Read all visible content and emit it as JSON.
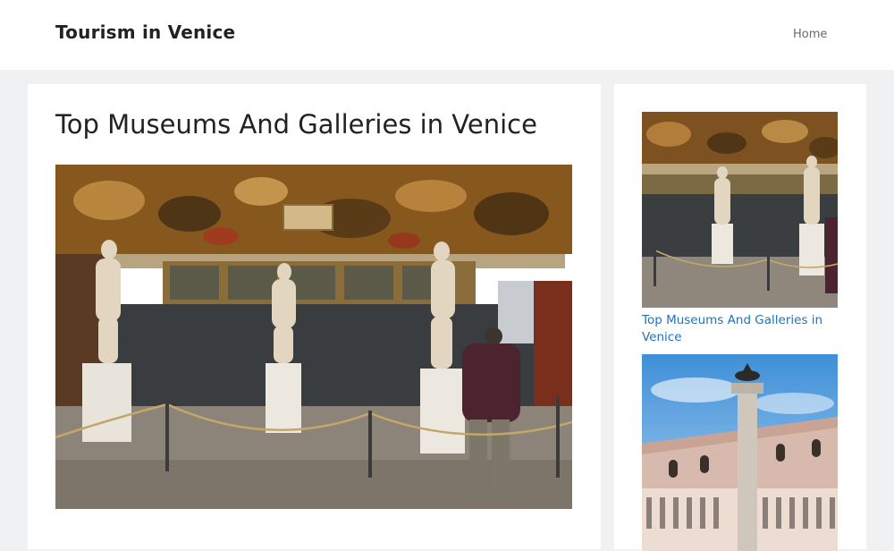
{
  "header": {
    "site_title": "Tourism in Venice",
    "nav": [
      {
        "label": "Home"
      }
    ]
  },
  "article": {
    "title": "Top Museums And Galleries in Venice"
  },
  "sidebar": {
    "posts": [
      {
        "title": "Top Museums And Galleries in Venice"
      },
      {
        "title": ""
      }
    ]
  },
  "colors": {
    "background": "#f0f1f3",
    "card": "#ffffff",
    "link": "#1e73be",
    "text": "#222222"
  }
}
